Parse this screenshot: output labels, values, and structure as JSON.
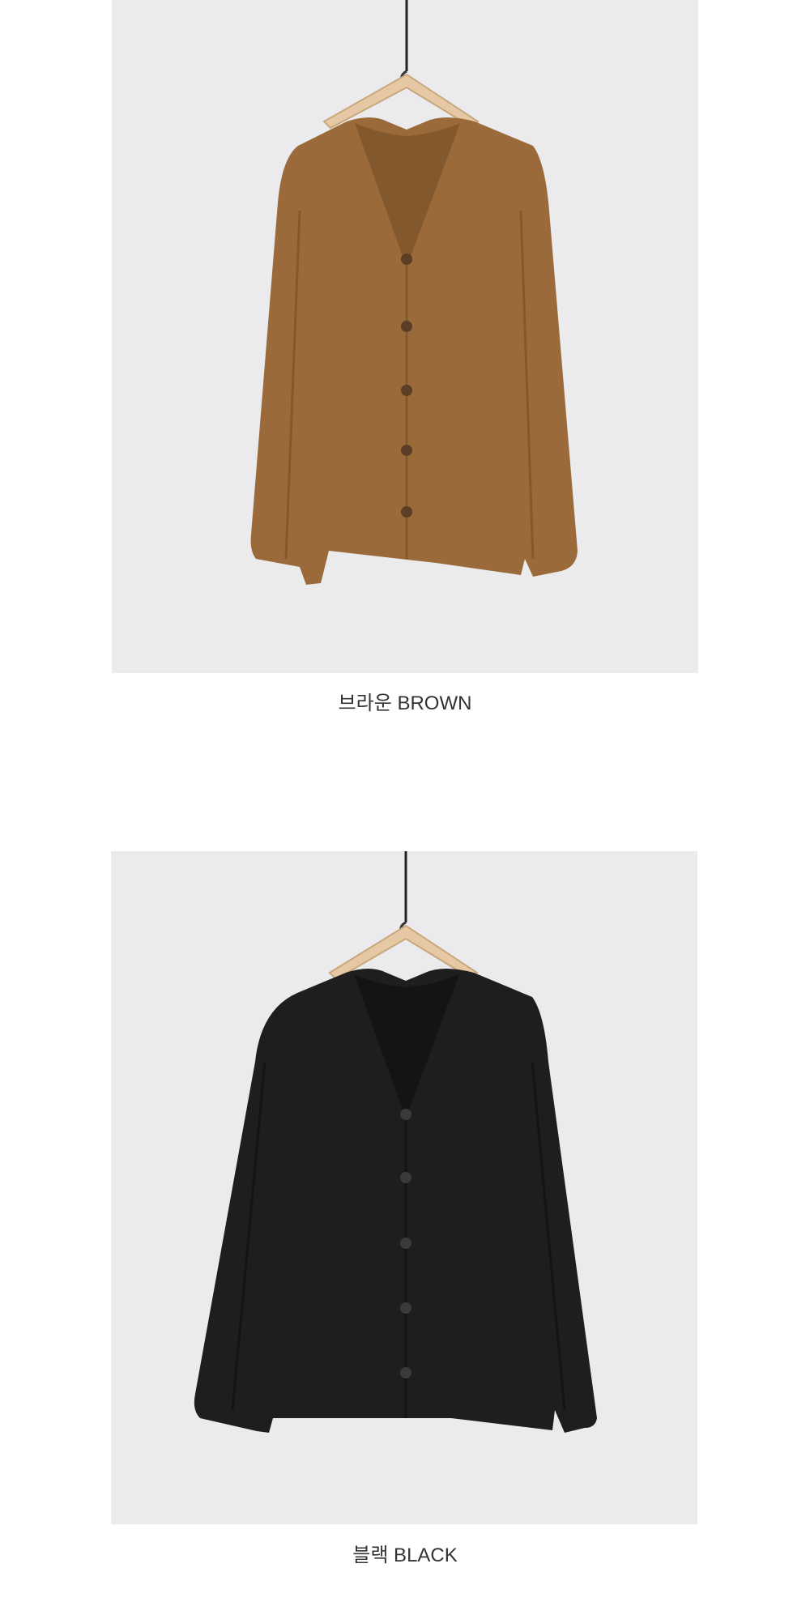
{
  "products": [
    {
      "id": "brown",
      "caption": "브라운 BROWN",
      "garment_color": "#9a6a3a",
      "garment_shadow": "#84582d",
      "button_color": "#5a3e26"
    },
    {
      "id": "black",
      "caption": "블랙 BLACK",
      "garment_color": "#1e1e1e",
      "garment_shadow": "#141414",
      "button_color": "#3a3a3a"
    }
  ],
  "background_color": "#ebebed",
  "hanger_color": "#e6c9a4"
}
